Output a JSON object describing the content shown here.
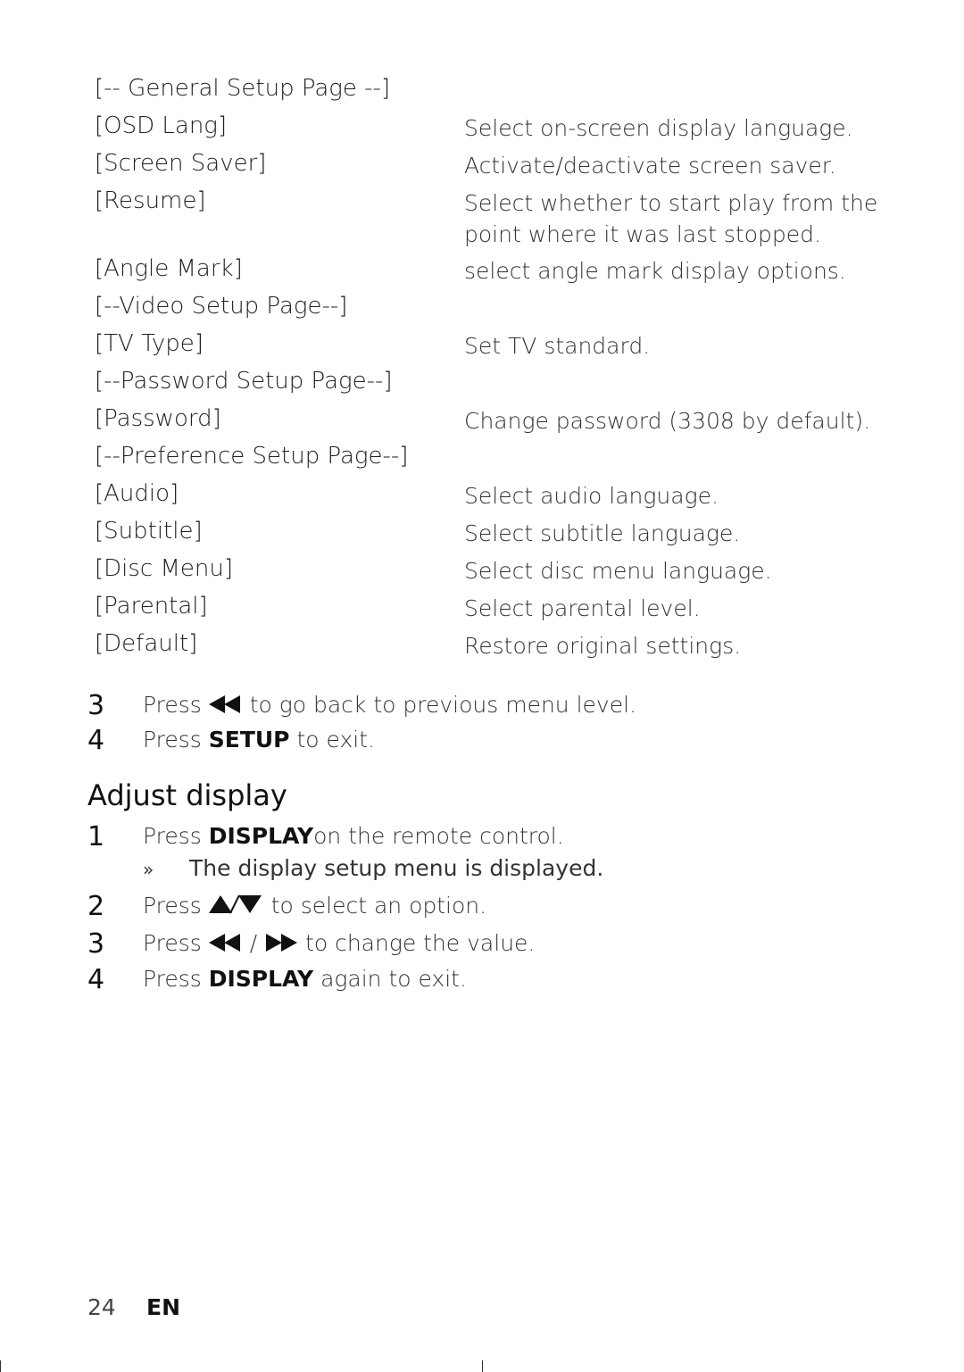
{
  "setup_table": [
    {
      "term": "[-- General Setup Page --]",
      "desc": ""
    },
    {
      "term": "[OSD Lang]",
      "desc": "Select on-screen display language."
    },
    {
      "term": "[Screen Saver]",
      "desc": "Activate/deactivate screen saver."
    },
    {
      "term": "[Resume]",
      "desc": "Select whether to start play from the",
      "desc2": "point where it was last stopped."
    },
    {
      "term": "[Angle Mark]",
      "desc": "select angle mark display options."
    },
    {
      "term": "[--Video Setup Page--]",
      "desc": ""
    },
    {
      "term": "[TV Type]",
      "desc": "Set TV standard."
    },
    {
      "term": "[--Password Setup Page--]",
      "desc": ""
    },
    {
      "term": "[Password]",
      "desc": "Change password (3308 by default)."
    },
    {
      "term": "[--Preference Setup Page--]",
      "desc": ""
    },
    {
      "term": "[Audio]",
      "desc": "Select audio language."
    },
    {
      "term": "[Subtitle]",
      "desc": "Select subtitle language."
    },
    {
      "term": "[Disc Menu]",
      "desc": "Select disc menu language."
    },
    {
      "term": "[Parental]",
      "desc": "Select parental level."
    },
    {
      "term": "[Default]",
      "desc": "Restore original settings."
    }
  ],
  "setup_steps": [
    {
      "num": "3",
      "pre": "Press ",
      "bold": "",
      "icon": "rewind-icon",
      "post": " to go back to previous menu level."
    },
    {
      "num": "4",
      "pre": "Press ",
      "bold": "SETUP",
      "icon": "",
      "post": " to exit."
    }
  ],
  "adjust_display": {
    "heading": "Adjust display",
    "steps": [
      {
        "num": "1",
        "pre": "Press ",
        "bold": "DISPLAY",
        "post": "on the remote control.",
        "result_mark": "»",
        "result": "The display setup menu is displayed."
      },
      {
        "num": "2",
        "pre": "Press ",
        "icons": "up-down-icon",
        "post": " to select an option."
      },
      {
        "num": "3",
        "pre": "Press ",
        "icons": "rewind-forward-icon",
        "sep": " / ",
        "post": " to change the value."
      },
      {
        "num": "4",
        "pre": "Press ",
        "bold": "DISPLAY",
        "post": " again to exit."
      }
    ]
  },
  "footer": {
    "page_number": "24",
    "language": "EN"
  }
}
